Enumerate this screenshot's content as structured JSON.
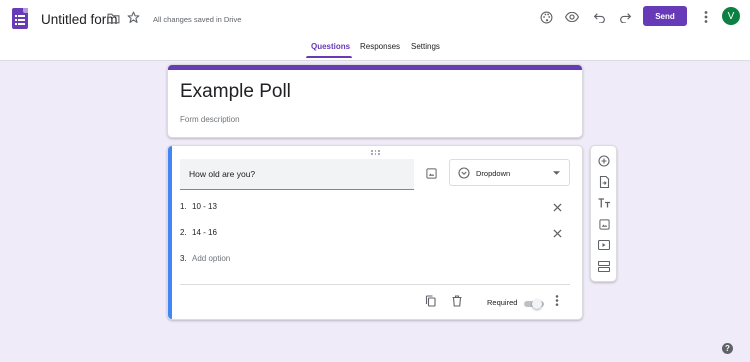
{
  "header": {
    "title": "Untitled form",
    "save_status": "All changes saved in Drive",
    "send_label": "Send",
    "avatar_initial": "V"
  },
  "tabs": [
    {
      "label": "Questions",
      "active": true
    },
    {
      "label": "Responses",
      "active": false
    },
    {
      "label": "Settings",
      "active": false
    }
  ],
  "form": {
    "title": "Example Poll",
    "description_placeholder": "Form description"
  },
  "question": {
    "text": "How old are you?",
    "type": "Dropdown",
    "options": [
      {
        "num": "1.",
        "label": "10 - 13"
      },
      {
        "num": "2.",
        "label": "14 - 16"
      }
    ],
    "add_option": {
      "num": "3.",
      "label": "Add option"
    },
    "required_label": "Required",
    "required": false
  },
  "help": "?",
  "colors": {
    "accent": "#673ab7",
    "background": "#f0ebf8",
    "question_focus": "#4285f4",
    "avatar": "#0b8043"
  },
  "icons": {
    "header": [
      "forms-logo-icon",
      "folder-icon",
      "star-icon",
      "palette-icon",
      "preview-eye-icon",
      "undo-icon",
      "redo-icon",
      "more-vert-icon"
    ],
    "side_toolbar": [
      "add-question-icon",
      "import-questions-icon",
      "title-text-icon",
      "image-icon",
      "video-icon",
      "section-icon"
    ],
    "question": [
      "drag-handle-icon",
      "insert-image-icon",
      "dropdown-type-icon",
      "arrow-drop-down-icon",
      "remove-option-icon",
      "duplicate-icon",
      "delete-icon",
      "more-vert-icon"
    ]
  }
}
